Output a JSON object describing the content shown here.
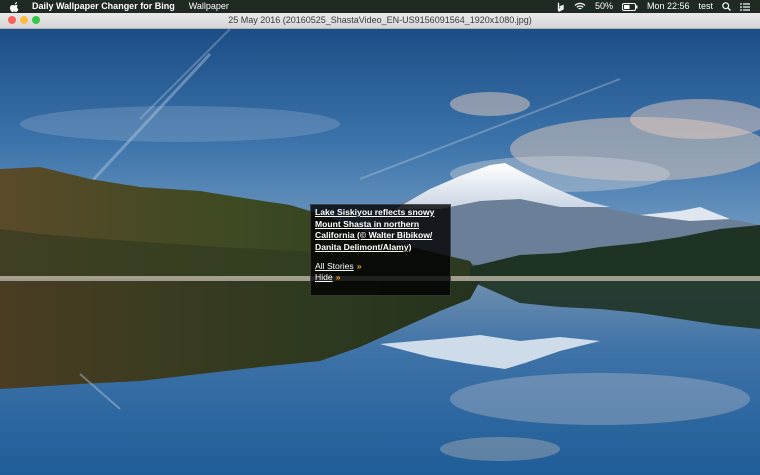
{
  "menubar": {
    "app_name": "Daily Wallpaper Changer for Bing",
    "menu": "Wallpaper",
    "battery": "50%",
    "clock": "Mon 22:56",
    "user": "test"
  },
  "window": {
    "title": "25 May 2016 (20160525_ShastaVideo_EN-US9156091564_1920x1080.jpg)"
  },
  "story": {
    "caption": "Lake Siskiyou reflects snowy Mount Shasta in northern California (© Walter Bibikow/ Danita Delimont/Alamy)",
    "all_stories": "All Stories",
    "hide": "Hide",
    "arrow": "»"
  },
  "colors": {
    "menubar_bg": "#1f2a22",
    "link_arrow": "#f5a623"
  }
}
